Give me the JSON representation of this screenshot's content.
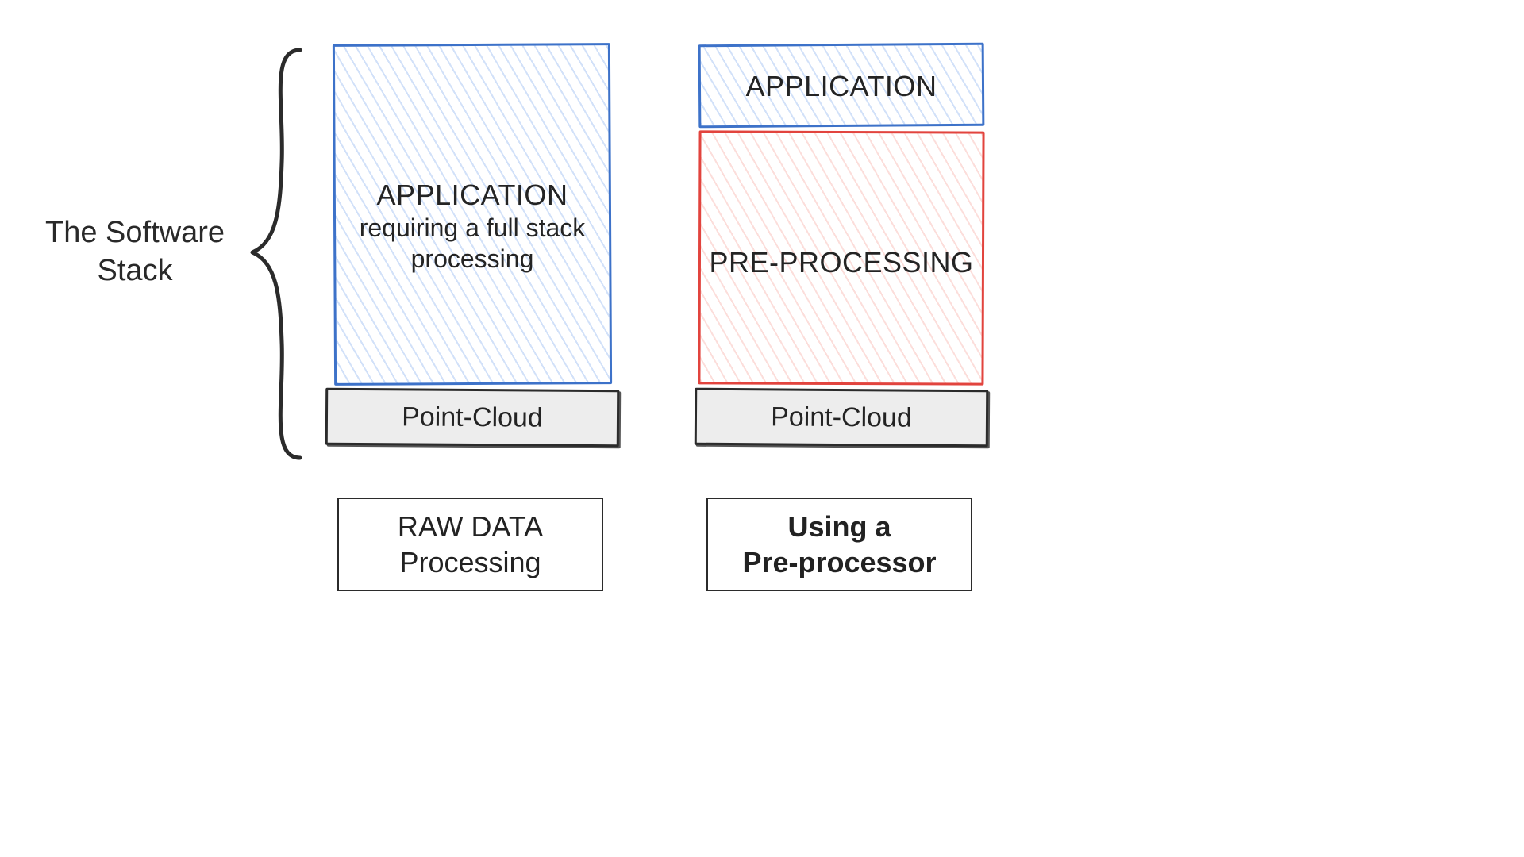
{
  "side_label": {
    "line1": "The Software",
    "line2": "Stack"
  },
  "left_stack": {
    "app_title": "APPLICATION",
    "app_sub1": "requiring a full stack",
    "app_sub2": "processing",
    "base": "Point-Cloud",
    "caption_line1": "RAW DATA",
    "caption_line2": "Processing"
  },
  "right_stack": {
    "app_title": "APPLICATION",
    "mid_title": "PRE-PROCESSING",
    "base": "Point-Cloud",
    "caption_line1": "Using a",
    "caption_line2": "Pre-processor"
  },
  "colors": {
    "blue": "#3d72c9",
    "red": "#e2443e",
    "ink": "#2b2b2b"
  }
}
